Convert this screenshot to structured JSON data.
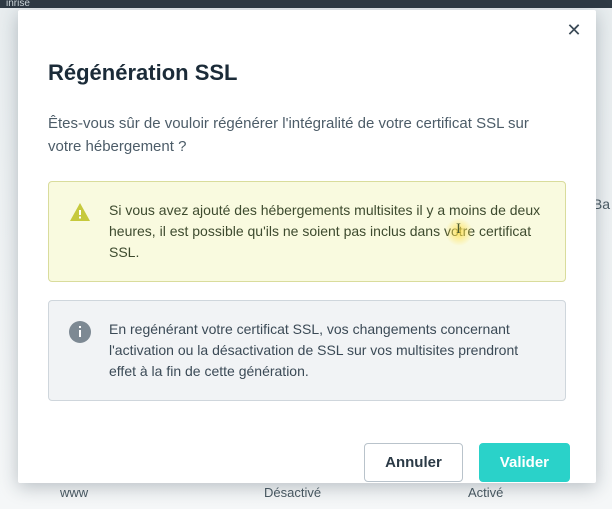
{
  "backdrop": {
    "topbar_fragment": "inrise",
    "cells": [
      "www",
      "Désactivé",
      "Activé"
    ],
    "right_fragment": "Ba"
  },
  "modal": {
    "close_glyph": "✕",
    "title": "Régénération SSL",
    "lead": "Êtes-vous sûr de vouloir régénérer l'intégralité de votre certificat SSL sur votre hébergement ?",
    "warning": "Si vous avez ajouté des hébergements multisites il y a moins de deux heures, il est possible qu'ils ne soient pas inclus dans votre certificat SSL.",
    "info": "En regénérant votre certificat SSL, vos changements concernant l'activation ou la désactivation de SSL sur vos multisites prendront effet à la fin de cette génération.",
    "buttons": {
      "cancel": "Annuler",
      "confirm": "Valider"
    }
  }
}
